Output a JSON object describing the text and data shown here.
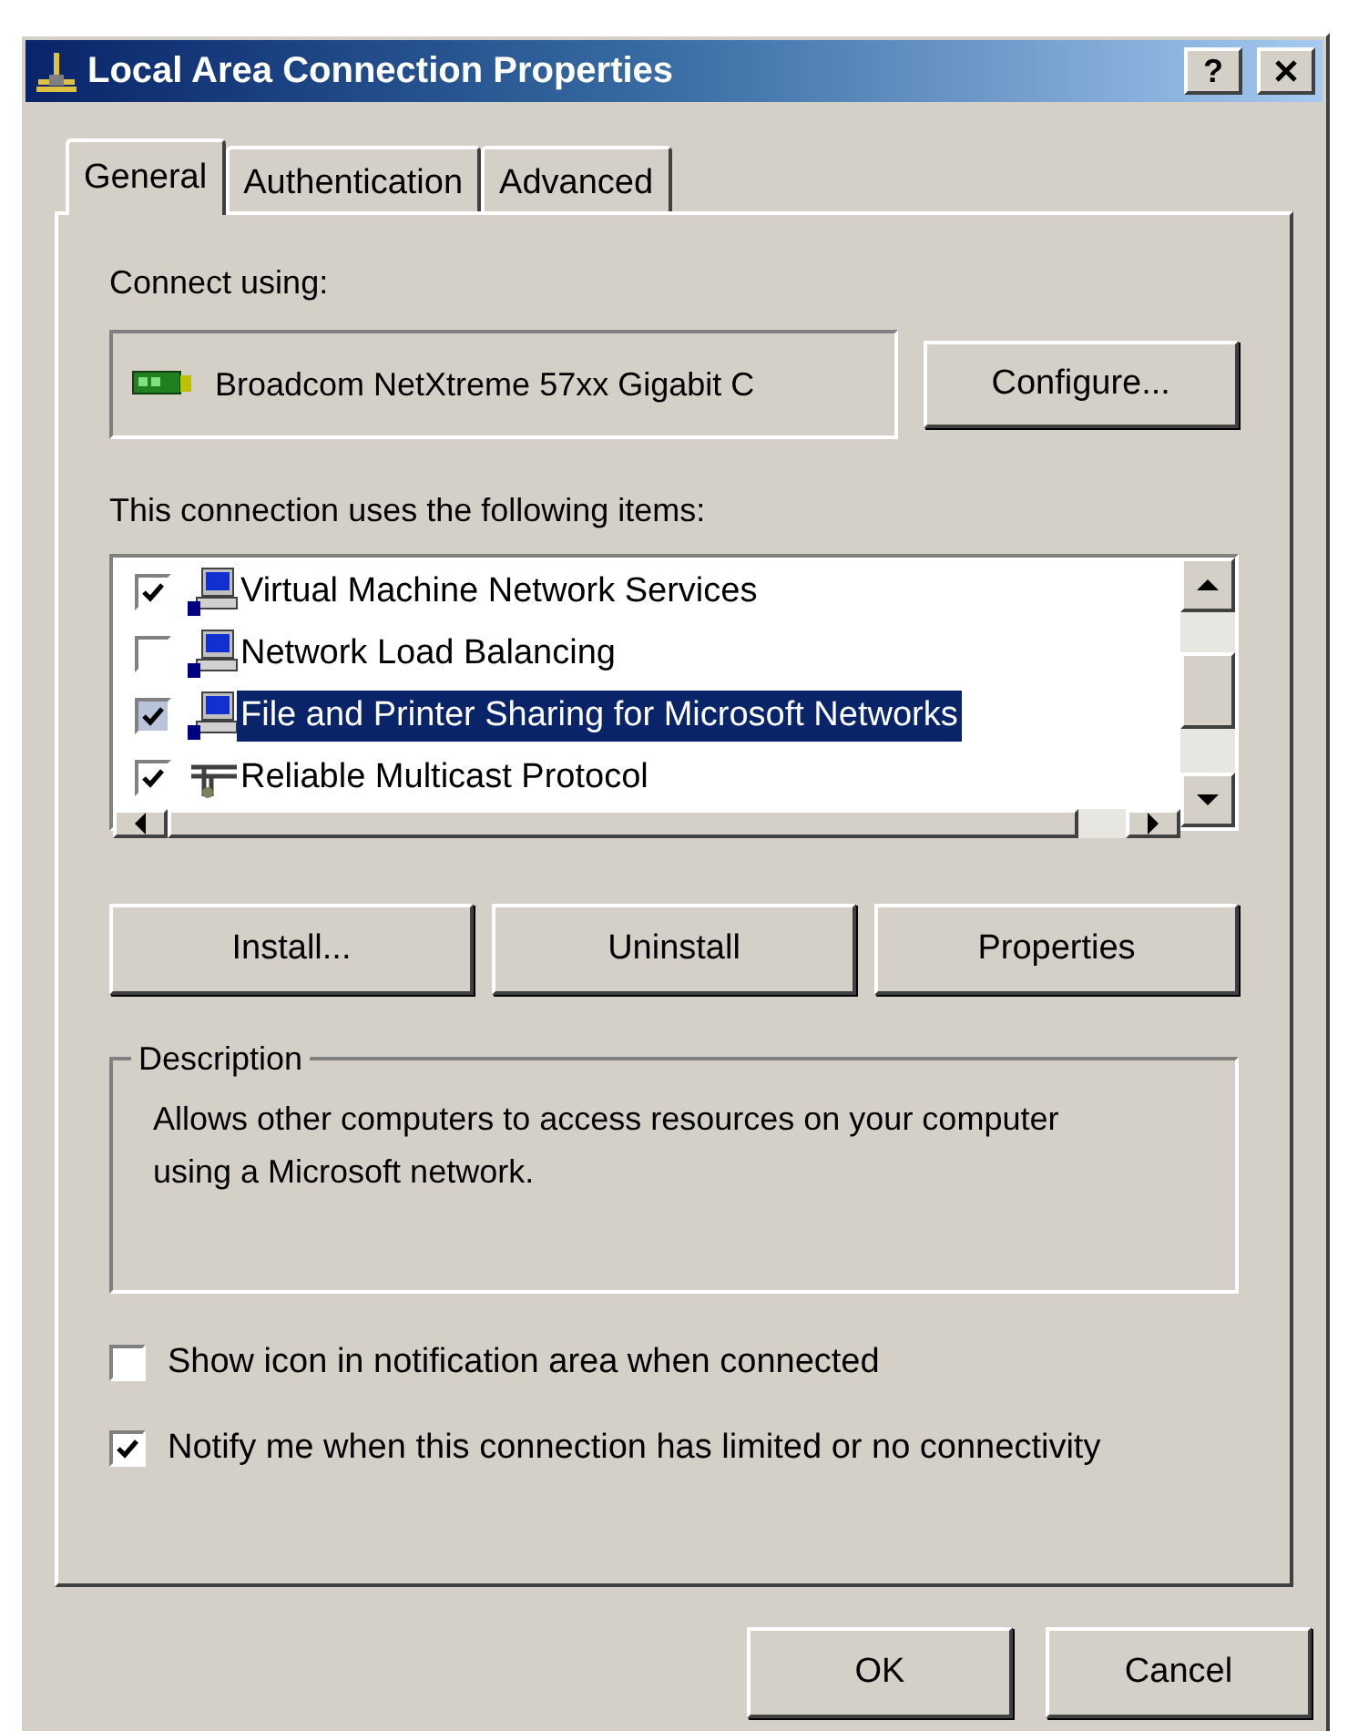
{
  "window": {
    "title": "Local Area Connection Properties",
    "help_button": "?"
  },
  "tabs": [
    {
      "label": "General",
      "selected": true
    },
    {
      "label": "Authentication",
      "selected": false
    },
    {
      "label": "Advanced",
      "selected": false
    }
  ],
  "connect_using": {
    "label": "Connect using:",
    "adapter": "Broadcom NetXtreme 57xx Gigabit C",
    "button": "Configure..."
  },
  "items_label": "This connection uses the following items:",
  "items": [
    {
      "label": "Virtual Machine Network Services",
      "checked": true,
      "selected": false,
      "kind": "service"
    },
    {
      "label": "Network Load Balancing",
      "checked": false,
      "selected": false,
      "kind": "service"
    },
    {
      "label": "File and Printer Sharing for Microsoft Networks",
      "checked": true,
      "selected": true,
      "kind": "service"
    },
    {
      "label": "Reliable Multicast Protocol",
      "checked": true,
      "selected": false,
      "kind": "protocol"
    }
  ],
  "item_buttons": [
    "Install...",
    "Uninstall",
    "Properties"
  ],
  "description": {
    "title": "Description",
    "text": "Allows other computers to access resources on your computer using a Microsoft network."
  },
  "options": [
    {
      "label": "Show icon in notification area when connected",
      "checked": false
    },
    {
      "label": "Notify me when this connection has limited or no connectivity",
      "checked": true
    }
  ],
  "dialog_buttons": [
    "OK",
    "Cancel"
  ]
}
